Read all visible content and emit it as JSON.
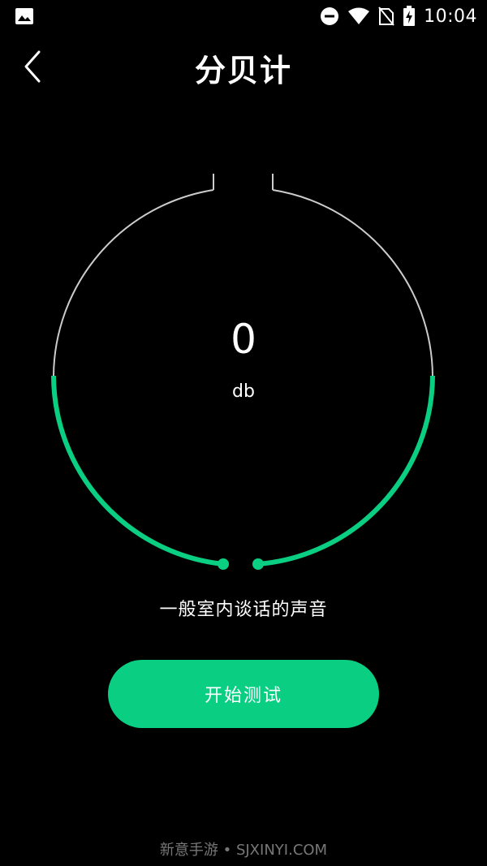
{
  "status_bar": {
    "time": "10:04",
    "icons": [
      "gallery-icon",
      "do-not-disturb-icon",
      "wifi-icon",
      "no-sim-icon",
      "battery-charging-icon"
    ]
  },
  "header": {
    "title": "分贝计",
    "back_icon": "back-arrow-icon"
  },
  "meter": {
    "value": "0",
    "unit": "db",
    "level_fraction": 0.5,
    "colors": {
      "track": "#cccccc",
      "active": "#0acf83"
    }
  },
  "description": "一般室内谈话的声音",
  "start_button": {
    "label": "开始测试",
    "color": "#0acf83"
  },
  "watermark": "新意手游 • SJXINYI.COM"
}
